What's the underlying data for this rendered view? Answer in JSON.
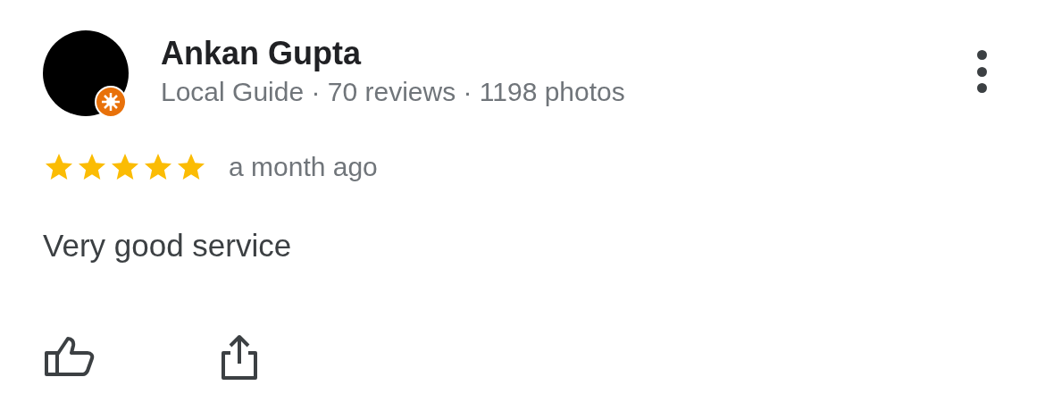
{
  "reviewer": {
    "name": "Ankan Gupta",
    "subtitle": "Local Guide · 70 reviews · 1198 photos",
    "local_guide": true
  },
  "review": {
    "stars": 5,
    "time": "a month ago",
    "text": "Very good service"
  }
}
